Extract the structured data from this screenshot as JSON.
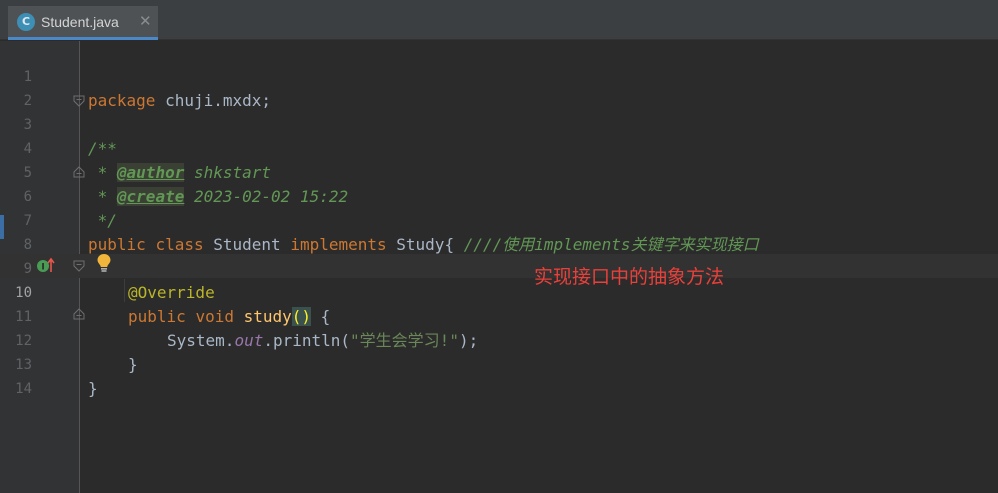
{
  "tab": {
    "icon_letter": "C",
    "file_name": "Student.java",
    "close_glyph": "✕"
  },
  "lines": {
    "n1": "1",
    "n2": "2",
    "n3": "3",
    "n4": "4",
    "n5": "5",
    "n6": "6",
    "n7": "7",
    "n8": "8",
    "n9": "9",
    "n10": "10",
    "n11": "11",
    "n12": "12",
    "n13": "13",
    "n14": "14"
  },
  "code": {
    "l1_kw": "package",
    "l1_rest": " chuji.mxdx;",
    "l3": "/**",
    "l4_star": " * ",
    "l4_tag": "@author",
    "l4_val": " shkstart",
    "l5_star": " * ",
    "l5_tag": "@create",
    "l5_val": " 2023-02-02 15:22",
    "l6": " */",
    "l7_kw1": "public",
    "l7_kw2": "class",
    "l7_name": " Student ",
    "l7_kw3": "implements",
    "l7_iface": " Study{ ",
    "l7_comment": "////使用implements关键字来实现接口",
    "l9_ann": "@Override",
    "l10_kw1": "public",
    "l10_kw2": "void",
    "l10_fn": "study",
    "l10_paren": "()",
    "l10_brace": " {",
    "l11_sys": "System.",
    "l11_out": "out",
    "l11_call": ".println(",
    "l11_str": "\"学生会学习!\"",
    "l11_end": ");",
    "l12": "}",
    "l13": "}"
  },
  "annotation_text": "实现接口中的抽象方法",
  "colors": {
    "background": "#2b2b2b",
    "keyword": "#cc7832",
    "comment": "#629755",
    "annotation_note": "#e8403a"
  },
  "icons": {
    "gutter_line10": "implements-method-icon",
    "bulb": "lightbulb-icon"
  }
}
